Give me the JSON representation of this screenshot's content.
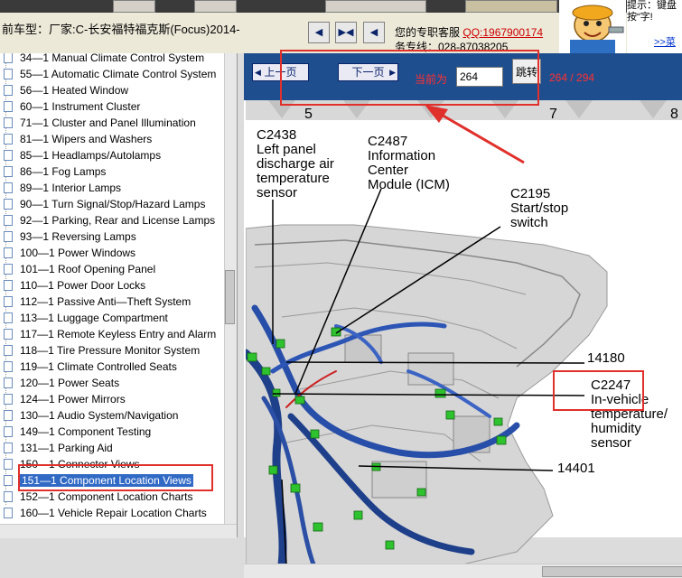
{
  "header": {
    "car_label": "前车型：厂家:C-长安福特福克斯(Focus)2014-",
    "service_line": "您的专职客服",
    "qq": "QQ:1967900174",
    "phone": "务专线：028-87038205",
    "tip": "提示：键盘按“字!",
    "tip_link": ">>菜"
  },
  "pager": {
    "prev": "上一页",
    "next": "下一页",
    "current_label": "当前为",
    "page_value": "264",
    "jump": "跳转",
    "count": "264 / 294"
  },
  "sidebar": {
    "items": [
      {
        "label": "34—1 Manual Climate Control System"
      },
      {
        "label": "55—1 Automatic Climate Control System"
      },
      {
        "label": "56—1 Heated Window"
      },
      {
        "label": "60—1 Instrument Cluster"
      },
      {
        "label": "71—1 Cluster and Panel Illumination"
      },
      {
        "label": "81—1 Wipers and Washers"
      },
      {
        "label": "85—1 Headlamps/Autolamps"
      },
      {
        "label": "86—1 Fog Lamps"
      },
      {
        "label": "89—1 Interior Lamps"
      },
      {
        "label": "90—1 Turn Signal/Stop/Hazard Lamps"
      },
      {
        "label": "92—1 Parking, Rear and License Lamps"
      },
      {
        "label": "93—1 Reversing Lamps"
      },
      {
        "label": "100—1 Power Windows"
      },
      {
        "label": "101—1 Roof Opening Panel"
      },
      {
        "label": "110—1 Power Door Locks"
      },
      {
        "label": "112—1 Passive Anti—Theft System"
      },
      {
        "label": "113—1 Luggage Compartment"
      },
      {
        "label": "117—1 Remote Keyless Entry and Alarm"
      },
      {
        "label": "118—1 Tire Pressure Monitor System"
      },
      {
        "label": "119—1 Climate Controlled Seats"
      },
      {
        "label": "120—1 Power Seats"
      },
      {
        "label": "124—1 Power Mirrors"
      },
      {
        "label": "130—1 Audio System/Navigation"
      },
      {
        "label": "149—1 Component Testing"
      },
      {
        "label": "131—1 Parking Aid"
      },
      {
        "label": "150—1 Connector Views"
      },
      {
        "label": "151—1 Component Location Views"
      },
      {
        "label": "152—1 Component Location Charts"
      },
      {
        "label": "160—1 Vehicle Repair Location Charts"
      }
    ],
    "selected_index": 26
  },
  "diagram": {
    "column_numbers": [
      "5",
      "7",
      "8"
    ],
    "labels": {
      "c2438_code": "C2438",
      "c2438_l1": "Left panel",
      "c2438_l2": "discharge air",
      "c2438_l3": "temperature",
      "c2438_l4": "sensor",
      "c2487_code": "C2487",
      "c2487_l1": "Information",
      "c2487_l2": "Center",
      "c2487_l3": "Module (ICM)",
      "c2195_code": "C2195",
      "c2195_l1": "Start/stop",
      "c2195_l2": "switch",
      "n14180": "14180",
      "c2247_code": "C2247",
      "c2247_l1": "In-vehicle",
      "c2247_l2": "temperature/",
      "c2247_l3": "humidity",
      "c2247_l4": "sensor",
      "n14401": "14401"
    }
  }
}
